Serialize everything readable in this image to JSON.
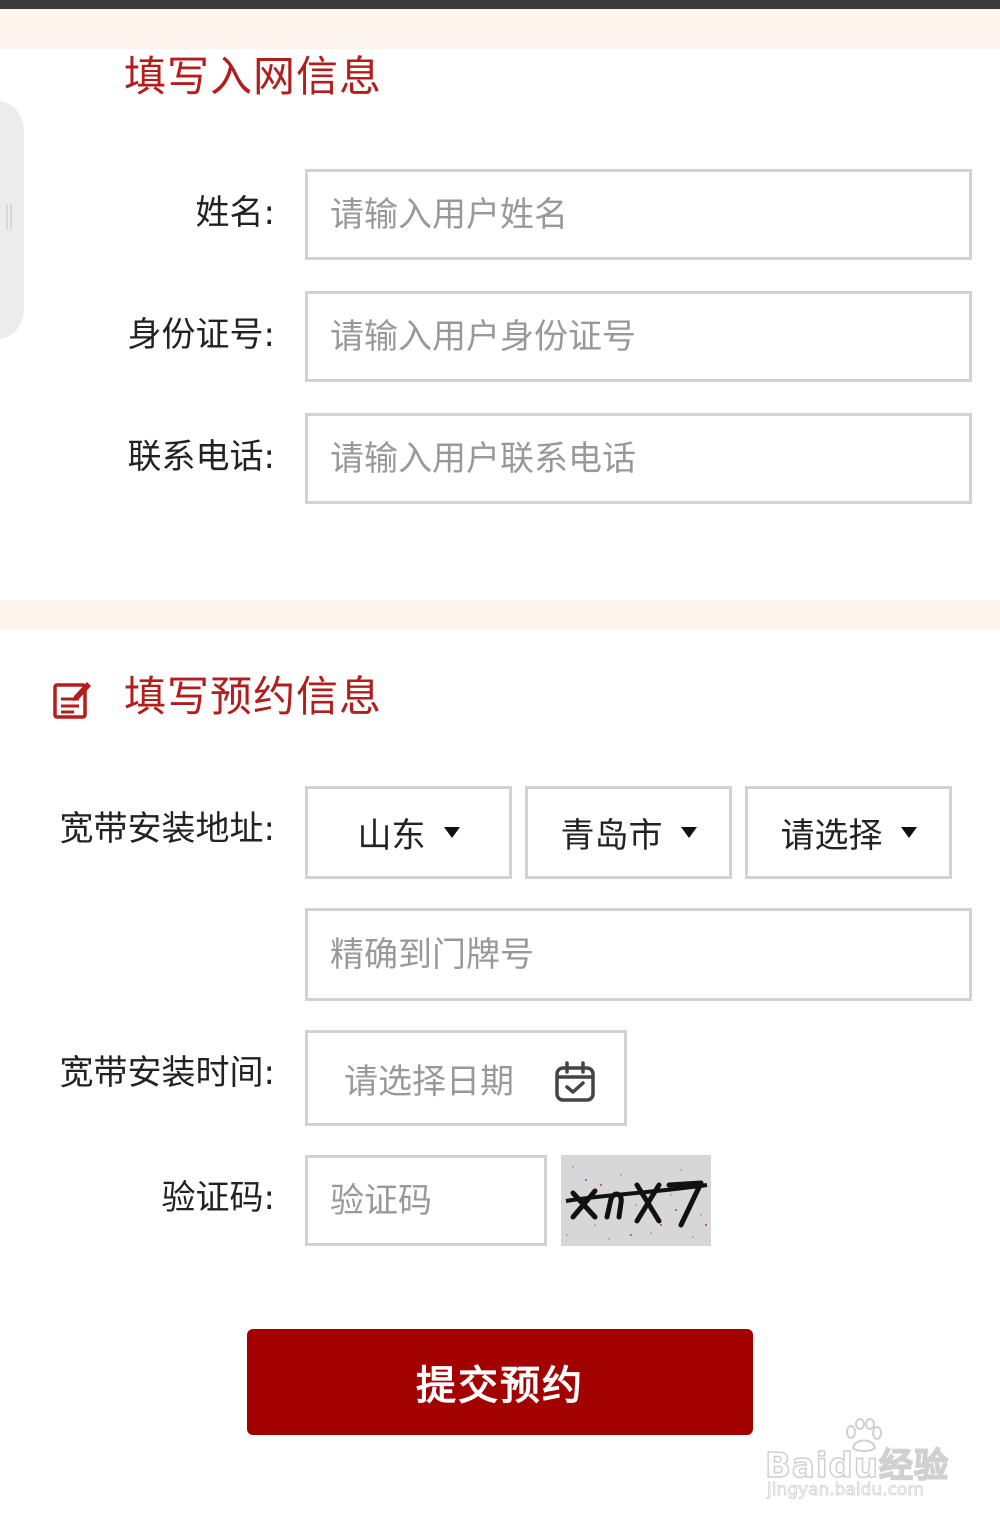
{
  "sections": {
    "network": {
      "title": "填写入网信息"
    },
    "booking": {
      "title": "填写预约信息"
    }
  },
  "form": {
    "name": {
      "label": "姓名:",
      "placeholder": "请输入用户姓名"
    },
    "id_number": {
      "label": "身份证号:",
      "placeholder": "请输入用户身份证号"
    },
    "phone": {
      "label": "联系电话:",
      "placeholder": "请输入用户联系电话"
    },
    "address": {
      "label": "宽带安装地址:",
      "province": "山东",
      "city": "青岛市",
      "district": "请选择",
      "detail_placeholder": "精确到门牌号"
    },
    "install_time": {
      "label": "宽带安装时间:",
      "placeholder": "请选择日期"
    },
    "captcha": {
      "label": "验证码:",
      "placeholder": "验证码",
      "image_text": "xnx7"
    }
  },
  "submit_label": "提交预约",
  "watermark": {
    "brand": "Baidu经验",
    "url": "jingyan.baidu.com"
  },
  "colors": {
    "accent": "#b41d1d",
    "button": "#a30000",
    "band": "#fdf4ee",
    "border": "#d2d2d2"
  },
  "icons": {
    "section_icon": "edit-form-icon",
    "date_icon": "calendar-check-icon",
    "select_arrow": "caret-down-icon"
  }
}
